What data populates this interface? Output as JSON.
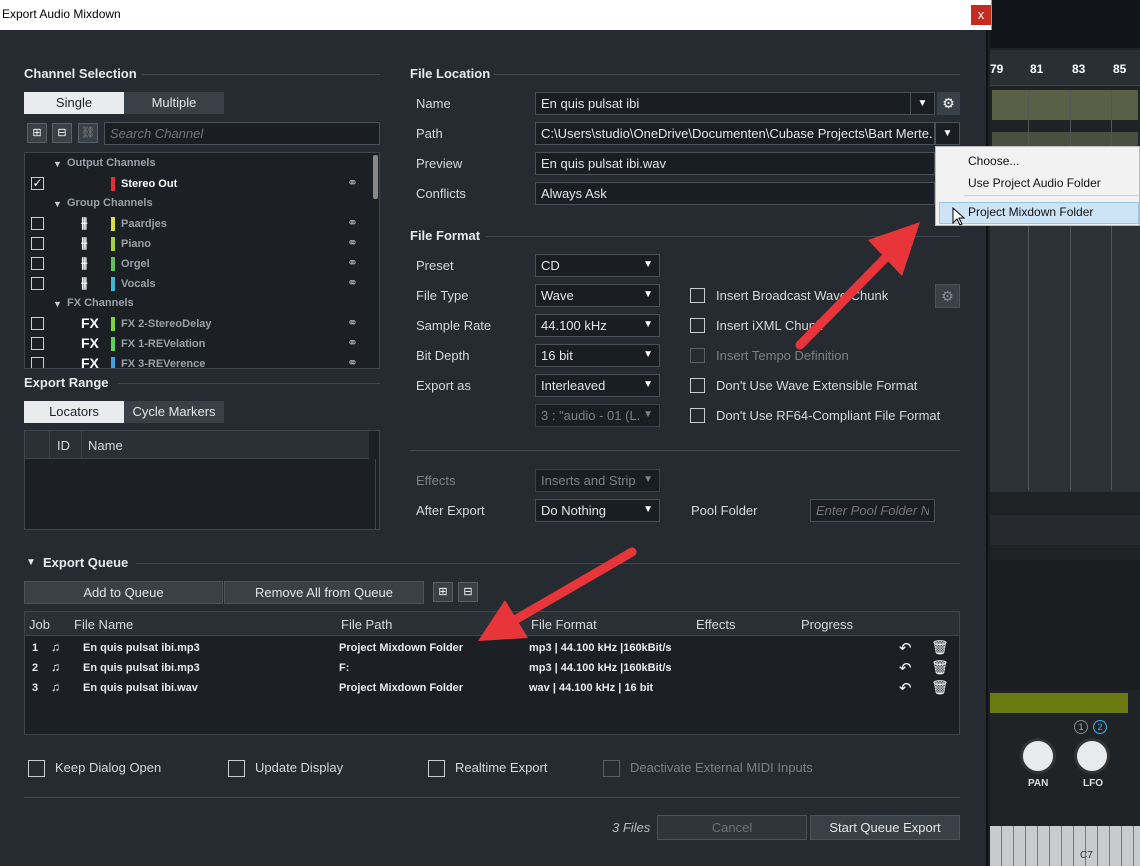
{
  "window": {
    "title": "Export Audio Mixdown",
    "close_label": "x"
  },
  "channel_selection": {
    "heading": "Channel Selection",
    "tabs": [
      "Single",
      "Multiple"
    ],
    "search_placeholder": "Search Channel",
    "groups": [
      {
        "label": "Output Channels",
        "items": [
          {
            "name": "Stereo Out",
            "color": "#e0303a",
            "checked": true
          }
        ]
      },
      {
        "label": "Group Channels",
        "items": [
          {
            "name": "Paardjes",
            "color": "#d4e040"
          },
          {
            "name": "Piano",
            "color": "#a0d040"
          },
          {
            "name": "Orgel",
            "color": "#60c060"
          },
          {
            "name": "Vocals",
            "color": "#40b8d0"
          }
        ]
      },
      {
        "label": "FX Channels",
        "items": [
          {
            "name": "FX 2-StereoDelay",
            "color": "#80d040"
          },
          {
            "name": "FX 1-REVelation",
            "color": "#60d060"
          },
          {
            "name": "FX 3-REVerence",
            "color": "#40a0e0"
          }
        ]
      }
    ],
    "fx_icon": "FX"
  },
  "export_range": {
    "heading": "Export Range",
    "tabs": [
      "Locators",
      "Cycle Markers"
    ],
    "columns": [
      "ID",
      "Name"
    ]
  },
  "file_location": {
    "heading": "File Location",
    "name_label": "Name",
    "name_value": "En quis pulsat ibi",
    "path_label": "Path",
    "path_value": "C:\\Users\\studio\\OneDrive\\Documenten\\Cubase Projects\\Bart Merte.",
    "preview_label": "Preview",
    "preview_value": "En quis pulsat ibi.wav",
    "conflicts_label": "Conflicts",
    "conflicts_value": "Always Ask"
  },
  "path_menu": {
    "items": [
      "Choose...",
      "Use Project Audio Folder",
      "Project Mixdown Folder"
    ]
  },
  "file_format": {
    "heading": "File Format",
    "preset_label": "Preset",
    "preset_value": "CD",
    "file_type_label": "File Type",
    "file_type_value": "Wave",
    "sample_rate_label": "Sample Rate",
    "sample_rate_value": "44.100 kHz",
    "bit_depth_label": "Bit Depth",
    "bit_depth_value": "16 bit",
    "export_as_label": "Export as",
    "export_as_value": "Interleaved",
    "channel_value": "3 : \"audio - 01 (L.",
    "options": [
      {
        "label": "Insert Broadcast Wave Chunk",
        "disabled": false
      },
      {
        "label": "Insert iXML Chunk",
        "disabled": false
      },
      {
        "label": "Insert Tempo Definition",
        "disabled": true
      },
      {
        "label": "Don't Use Wave Extensible Format",
        "disabled": false
      },
      {
        "label": "Don't Use RF64-Compliant File Format",
        "disabled": false
      }
    ],
    "effects_label": "Effects",
    "effects_value": "Inserts and Strip",
    "after_export_label": "After Export",
    "after_export_value": "Do Nothing",
    "pool_folder_label": "Pool Folder",
    "pool_folder_placeholder": "Enter Pool Folder N."
  },
  "export_queue": {
    "heading": "Export Queue",
    "add_label": "Add to Queue",
    "remove_label": "Remove All from Queue",
    "columns": [
      "Job",
      "File Name",
      "File Path",
      "File Format",
      "Effects",
      "Progress"
    ],
    "rows": [
      {
        "job": "1",
        "file": "En quis pulsat ibi.mp3",
        "path": "Project Mixdown Folder",
        "format": "mp3 | 44.100 kHz |160kBit/s"
      },
      {
        "job": "2",
        "file": "En quis pulsat ibi.mp3",
        "path": "F:",
        "format": "mp3 | 44.100 kHz |160kBit/s"
      },
      {
        "job": "3",
        "file": "En quis pulsat ibi.wav",
        "path": "Project Mixdown Folder",
        "format": "wav | 44.100 kHz | 16 bit"
      }
    ]
  },
  "footer": {
    "options": [
      {
        "label": "Keep Dialog Open",
        "disabled": false
      },
      {
        "label": "Update Display",
        "disabled": false
      },
      {
        "label": "Realtime Export",
        "disabled": false
      },
      {
        "label": "Deactivate External MIDI Inputs",
        "disabled": true
      }
    ],
    "files_count": "3 Files",
    "cancel_label": "Cancel",
    "start_label": "Start Queue Export"
  },
  "background": {
    "ruler": [
      "79",
      "81",
      "83",
      "85"
    ],
    "knobs": [
      "PAN",
      "LFO"
    ],
    "badges": [
      "1",
      "2"
    ],
    "note": "C7"
  },
  "colors": {
    "accent_arrow": "#e8353a",
    "highlight": "#cde4f7"
  }
}
